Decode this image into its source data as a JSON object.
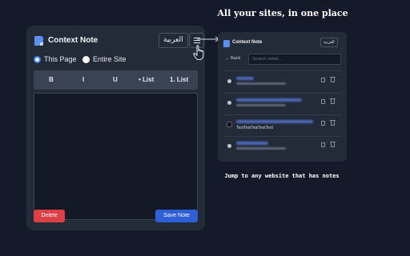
{
  "main_panel": {
    "app_title": "Context Note",
    "language_button": "العربية",
    "scope": {
      "this_page": "This Page",
      "entire_site": "Entire Site",
      "selected": "This Page"
    },
    "toolbar": {
      "bold": "B",
      "italic": "I",
      "underline": "U",
      "bullet_list": "• List",
      "numbered_list": "1. List"
    },
    "editor_value": "",
    "delete_label": "Delete",
    "save_label": "Save Note"
  },
  "promo": {
    "headline": "All your sites, in one place",
    "caption": "Jump to any website that has notes"
  },
  "preview_panel": {
    "app_title": "Context Note",
    "language_button": "العربية",
    "back_label": "← Back",
    "search_placeholder": "Search notes...",
    "items": [
      {
        "favicon": "globe",
        "subtitle_visible": ""
      },
      {
        "favicon": "globe",
        "subtitle_visible": ""
      },
      {
        "favicon": "app-dark",
        "subtitle_visible": "TestTestTestTestTest"
      },
      {
        "favicon": "globe",
        "subtitle_visible": ""
      }
    ]
  },
  "colors": {
    "background": "#151a2b",
    "panel": "#232a38",
    "accent": "#3b82f6",
    "delete": "#dc3f44",
    "save": "#2f5fd6"
  }
}
